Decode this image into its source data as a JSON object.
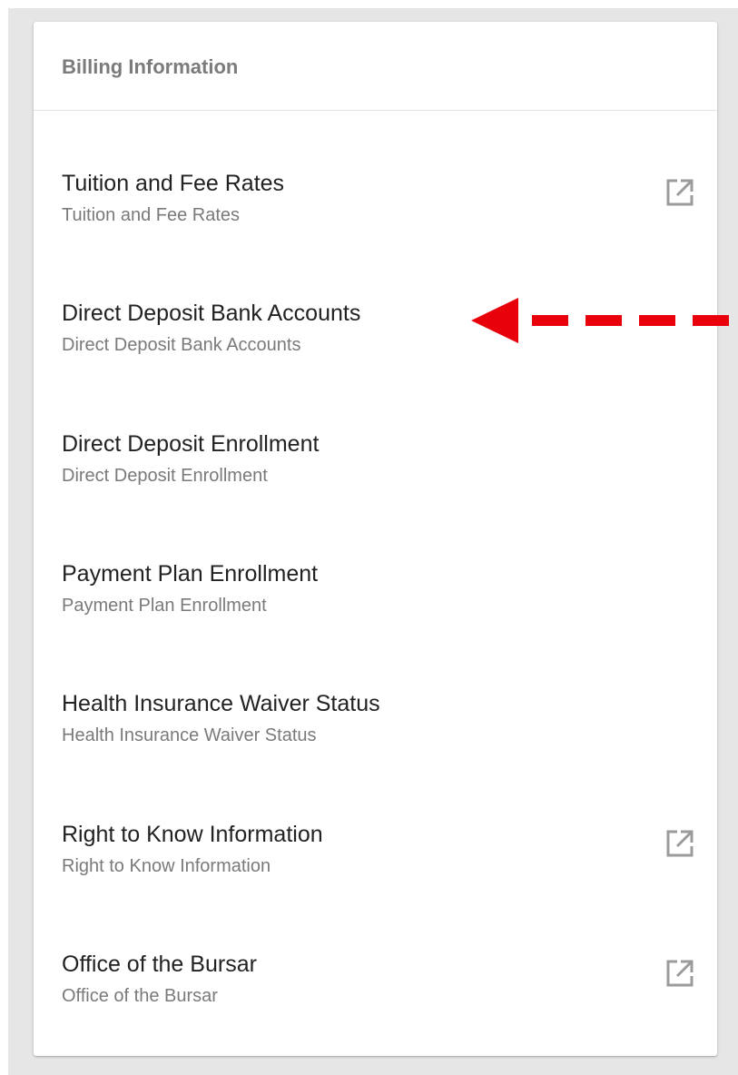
{
  "card": {
    "title": "Billing Information",
    "items": [
      {
        "title": "Tuition and Fee Rates",
        "subtitle": "Tuition and Fee Rates",
        "icon": "external-link-icon"
      },
      {
        "title": "Direct Deposit Bank Accounts",
        "subtitle": "Direct Deposit Bank Accounts",
        "icon": null
      },
      {
        "title": "Direct Deposit Enrollment",
        "subtitle": "Direct Deposit Enrollment",
        "icon": null
      },
      {
        "title": "Payment Plan Enrollment",
        "subtitle": "Payment Plan Enrollment",
        "icon": null
      },
      {
        "title": "Health Insurance Waiver Status",
        "subtitle": "Health Insurance Waiver Status",
        "icon": null
      },
      {
        "title": "Right to Know Information",
        "subtitle": "Right to Know Information",
        "icon": "external-link-icon"
      },
      {
        "title": "Office of the Bursar",
        "subtitle": "Office of the Bursar",
        "icon": "external-link-icon"
      }
    ]
  },
  "annotation": {
    "type": "dashed-arrow",
    "color": "#e8000b",
    "points_to": "Direct Deposit Bank Accounts"
  },
  "colors": {
    "frame": "#e6e6e6",
    "title_text": "#222222",
    "subtitle_text": "#7a7a7a",
    "header_text": "#7b7b7b",
    "icon": "#9b9b9b"
  }
}
